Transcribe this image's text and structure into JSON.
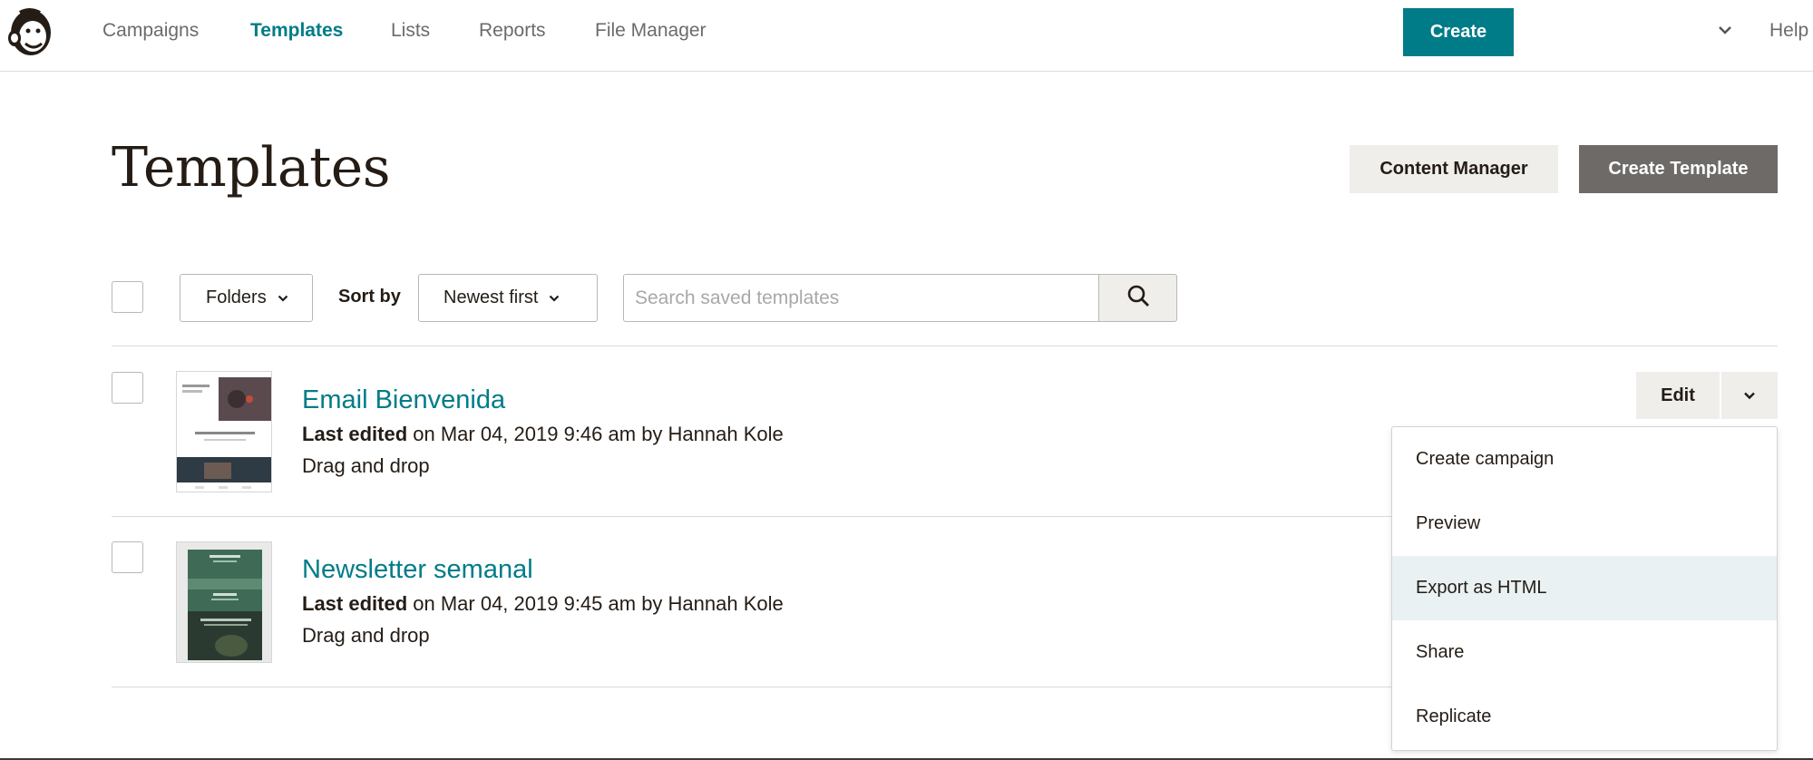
{
  "nav": {
    "items": [
      {
        "label": "Campaigns",
        "active": false
      },
      {
        "label": "Templates",
        "active": true
      },
      {
        "label": "Lists",
        "active": false
      },
      {
        "label": "Reports",
        "active": false
      },
      {
        "label": "File Manager",
        "active": false
      }
    ],
    "create_label": "Create",
    "help_label": "Help",
    "logo_icon": "mailchimp-freddie-icon",
    "account_icon": "chevron-down-icon"
  },
  "header": {
    "title": "Templates",
    "content_manager_label": "Content Manager",
    "create_template_label": "Create Template"
  },
  "toolbar": {
    "folders_label": "Folders",
    "sort_label": "Sort by",
    "sort_value": "Newest first",
    "search_placeholder": "Search saved templates",
    "search_icon": "search-icon"
  },
  "templates": [
    {
      "name": "Email Bienvenida",
      "edited_prefix": "Last edited",
      "edited_rest": " on Mar 04, 2019 9:46 am by Hannah Kole",
      "type": "Drag and drop"
    },
    {
      "name": "Newsletter semanal",
      "edited_prefix": "Last edited",
      "edited_rest": " on Mar 04, 2019 9:45 am by Hannah Kole",
      "type": "Drag and drop"
    }
  ],
  "row_actions": {
    "edit_label": "Edit"
  },
  "dropdown": {
    "items": [
      {
        "label": "Create campaign"
      },
      {
        "label": "Preview"
      },
      {
        "label": "Export as HTML"
      },
      {
        "label": "Share"
      },
      {
        "label": "Replicate"
      }
    ]
  },
  "colors": {
    "accent": "#007c89",
    "dark_button": "#6d6a67",
    "light_button": "#efeeea",
    "menu_hover": "#e9f1f2"
  }
}
